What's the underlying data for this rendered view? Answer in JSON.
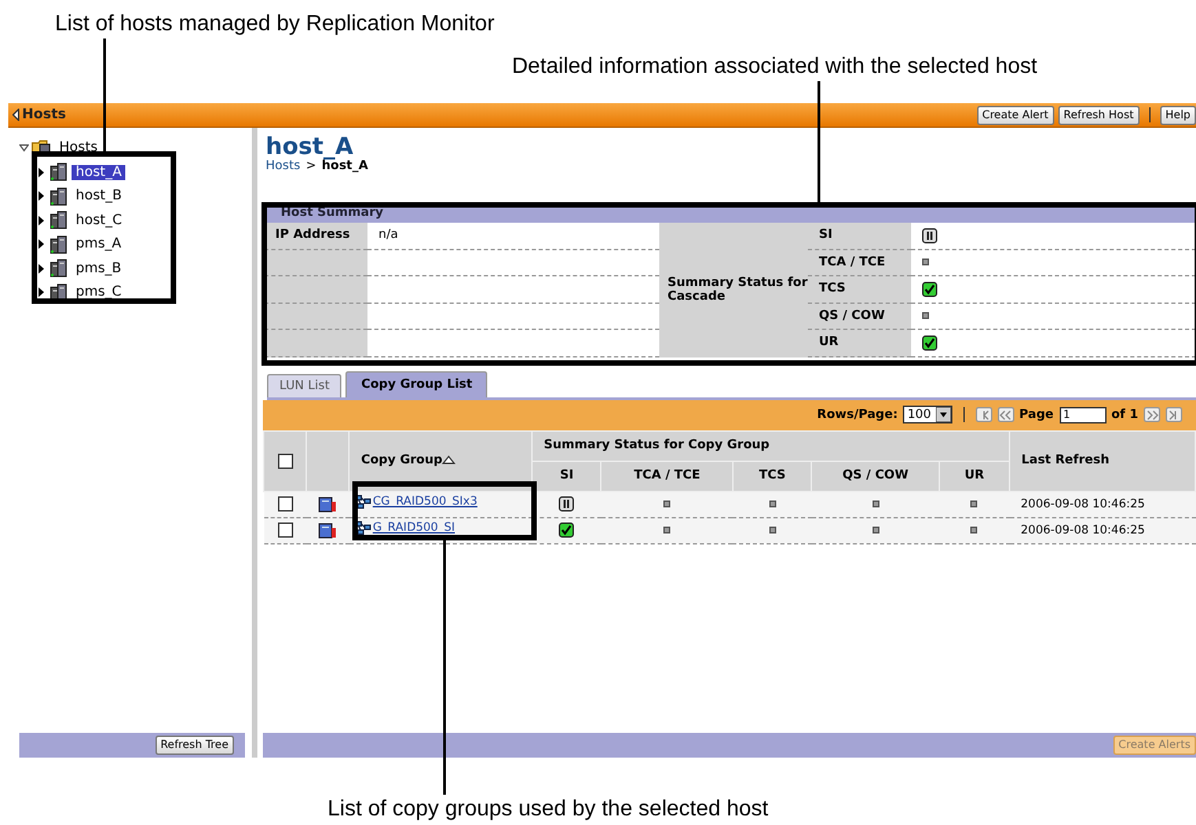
{
  "annotations": [
    {
      "text": "List of hosts managed by Replication Monitor"
    },
    {
      "text": "Detailed information associated with the selected host"
    },
    {
      "text": "List of copy groups used by the selected host"
    }
  ],
  "header": {
    "title": "Hosts",
    "buttons": [
      "Create Alert",
      "Refresh Host",
      "Help"
    ]
  },
  "tree": {
    "root": {
      "label": "Hosts",
      "expanded": true,
      "children": [
        {
          "label": "host_A",
          "selected": true,
          "expanded": false
        },
        {
          "label": "host_B",
          "selected": false,
          "expanded": false
        },
        {
          "label": "host_C",
          "selected": false,
          "expanded": false
        },
        {
          "label": "pms_A",
          "selected": false,
          "expanded": false
        },
        {
          "label": "pms_B",
          "selected": false,
          "expanded": false
        },
        {
          "label": "pms_C",
          "selected": false,
          "expanded": false
        }
      ]
    },
    "button": "Refresh Tree"
  },
  "detail": {
    "title": "host_A",
    "breadcrumb": {
      "parent": "Hosts",
      "separator": ">",
      "current": "host_A"
    },
    "host_summary": {
      "title": "Host Summary",
      "ip_label": "IP Address",
      "ip_value": "n/a",
      "cascade_label": "Summary Status for Cascade",
      "cascade": [
        {
          "name": "SI",
          "kind": "paused"
        },
        {
          "name": "TCA / TCE",
          "kind": "none"
        },
        {
          "name": "TCS",
          "kind": "ok"
        },
        {
          "name": "QS / COW",
          "kind": "none"
        },
        {
          "name": "UR",
          "kind": "ok"
        }
      ]
    },
    "tabs": [
      {
        "label": "LUN List",
        "selected": false
      },
      {
        "label": "Copy Group List",
        "selected": true
      }
    ],
    "pager": {
      "rows_label": "Rows/Page:",
      "rows_value": "100",
      "page_label": "Page",
      "page_value": "1",
      "of_label": "of 1"
    },
    "table": {
      "select_all": {
        "checked": false
      },
      "name_column": "Copy Group",
      "group_column": "Summary Status for Copy Group",
      "status_columns": [
        "SI",
        "TCA / TCE",
        "TCS",
        "QS / COW",
        "UR"
      ],
      "last_column": "Last Refresh",
      "rows": [
        {
          "checked": false,
          "name": "CG_RAID500_SIx3",
          "statuses": [
            {
              "kind": "paused"
            },
            {
              "kind": "none"
            },
            {
              "kind": "none"
            },
            {
              "kind": "none"
            },
            {
              "kind": "none"
            }
          ],
          "last_refresh": "2006-09-08 10:46:25"
        },
        {
          "checked": false,
          "name": "G_RAID500_SI",
          "statuses": [
            {
              "kind": "ok"
            },
            {
              "kind": "none"
            },
            {
              "kind": "none"
            },
            {
              "kind": "none"
            },
            {
              "kind": "none"
            }
          ],
          "last_refresh": "2006-09-08 10:46:25"
        }
      ]
    },
    "button": {
      "label": "Create Alerts",
      "disabled": true
    }
  }
}
